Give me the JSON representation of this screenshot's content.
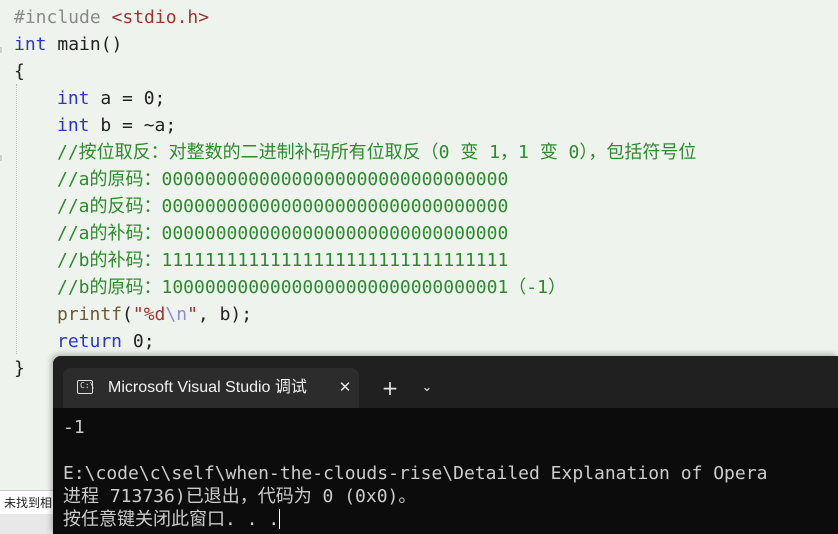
{
  "editor": {
    "lines": [
      {
        "pp": "#include ",
        "inc": "<stdio.h>"
      },
      {
        "kw": "int",
        "rest": " main()"
      },
      {
        "text": "{"
      },
      {
        "kw": "int",
        "rest": " a = 0;"
      },
      {
        "kw": "int",
        "rest": " b = ~a;"
      },
      {
        "comment": "//按位取反：对整数的二进制补码所有位取反（0 变 1，1 变 0），包括符号位"
      },
      {
        "comment": "//a的原码：00000000000000000000000000000000"
      },
      {
        "comment": "//a的反码：00000000000000000000000000000000"
      },
      {
        "comment": "//a的补码：00000000000000000000000000000000"
      },
      {
        "comment": "//b的补码：11111111111111111111111111111111"
      },
      {
        "comment": "//b的原码：10000000000000000000000000000001（-1）"
      },
      {
        "fn": "printf",
        "open": "(",
        "str1": "\"%d",
        "esc": "\\n",
        "str2": "\"",
        "rest": ", b);"
      },
      {
        "kw": "return",
        "rest": " 0;"
      },
      {
        "text": "}"
      }
    ]
  },
  "status_bar": {
    "text": "未找到相"
  },
  "terminal": {
    "tab_title": "Microsoft Visual Studio 调试",
    "close_glyph": "✕",
    "new_tab_glyph": "+",
    "dropdown_glyph": "⌄",
    "output": [
      "-1",
      "",
      "E:\\code\\c\\self\\when-the-clouds-rise\\Detailed Explanation of Opera",
      "进程 713736)已退出，代码为 0 (0x0)。",
      "按任意键关闭此窗口. . ."
    ]
  }
}
